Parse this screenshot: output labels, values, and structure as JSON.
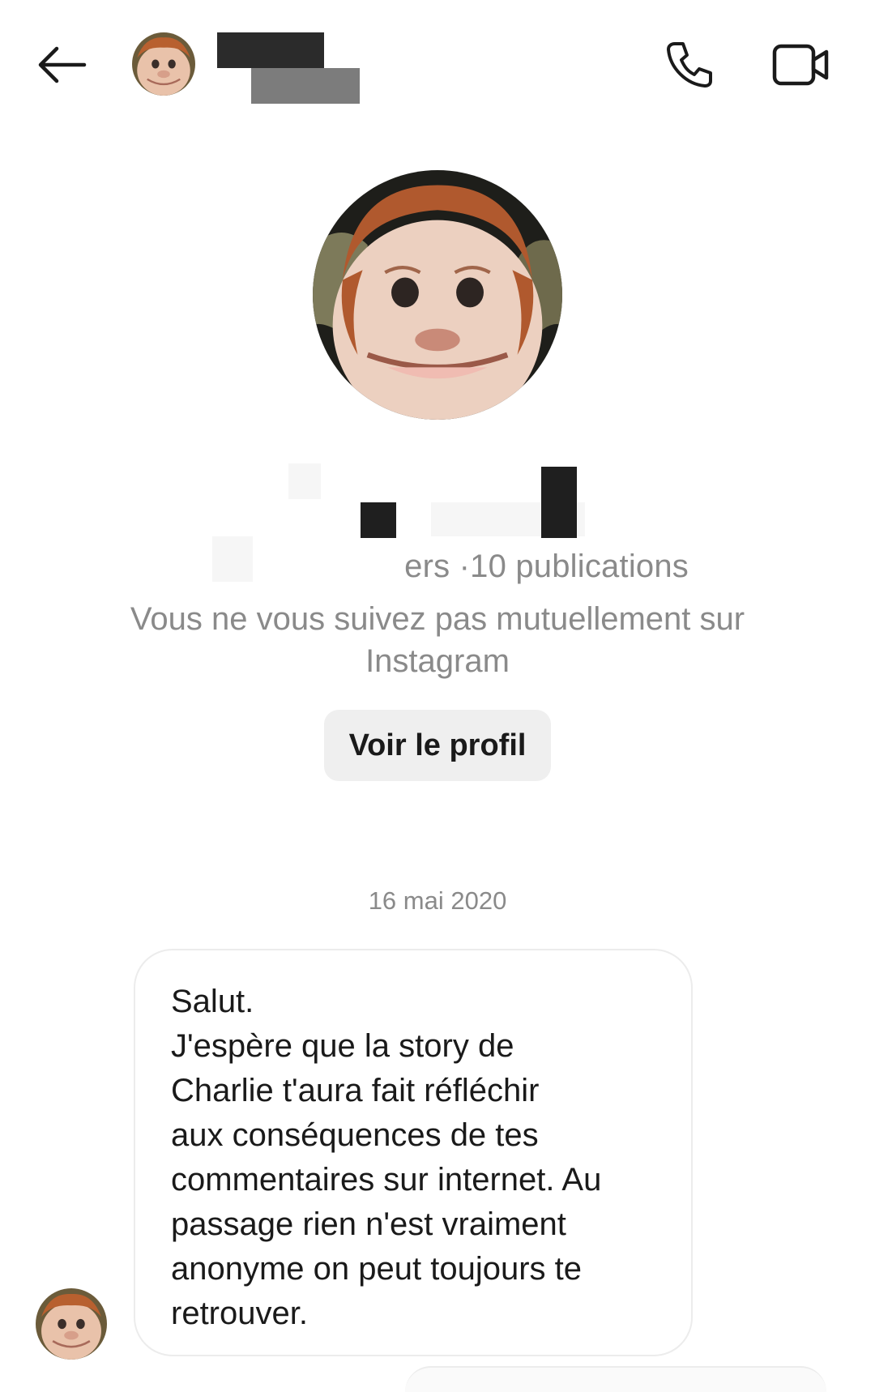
{
  "header": {
    "back_icon": "arrow-left-icon",
    "call_icon": "phone-icon",
    "video_icon": "video-camera-icon"
  },
  "profile": {
    "stats_visible": "ers ·10 publications",
    "mutual_follow_notice": "Vous ne vous suivez pas mutuellement sur Instagram",
    "view_profile_label": "Voir le profil"
  },
  "conversation": {
    "date_separator": "16 mai 2020",
    "messages": [
      {
        "text": "Salut.\nJ'espère que la story de\nCharlie t'aura fait réfléchir\naux conséquences de tes\ncommentaires sur internet. Au\npassage rien n'est vraiment\nanonyme on peut toujours te\nretrouver."
      }
    ]
  },
  "colors": {
    "background": "#ffffff",
    "secondary_text": "#8a8a8a",
    "button_bg": "#efefef",
    "bubble_border": "#ececec",
    "redaction_dark": "#2b2b2b",
    "redaction_gray": "#7c7c7c"
  }
}
